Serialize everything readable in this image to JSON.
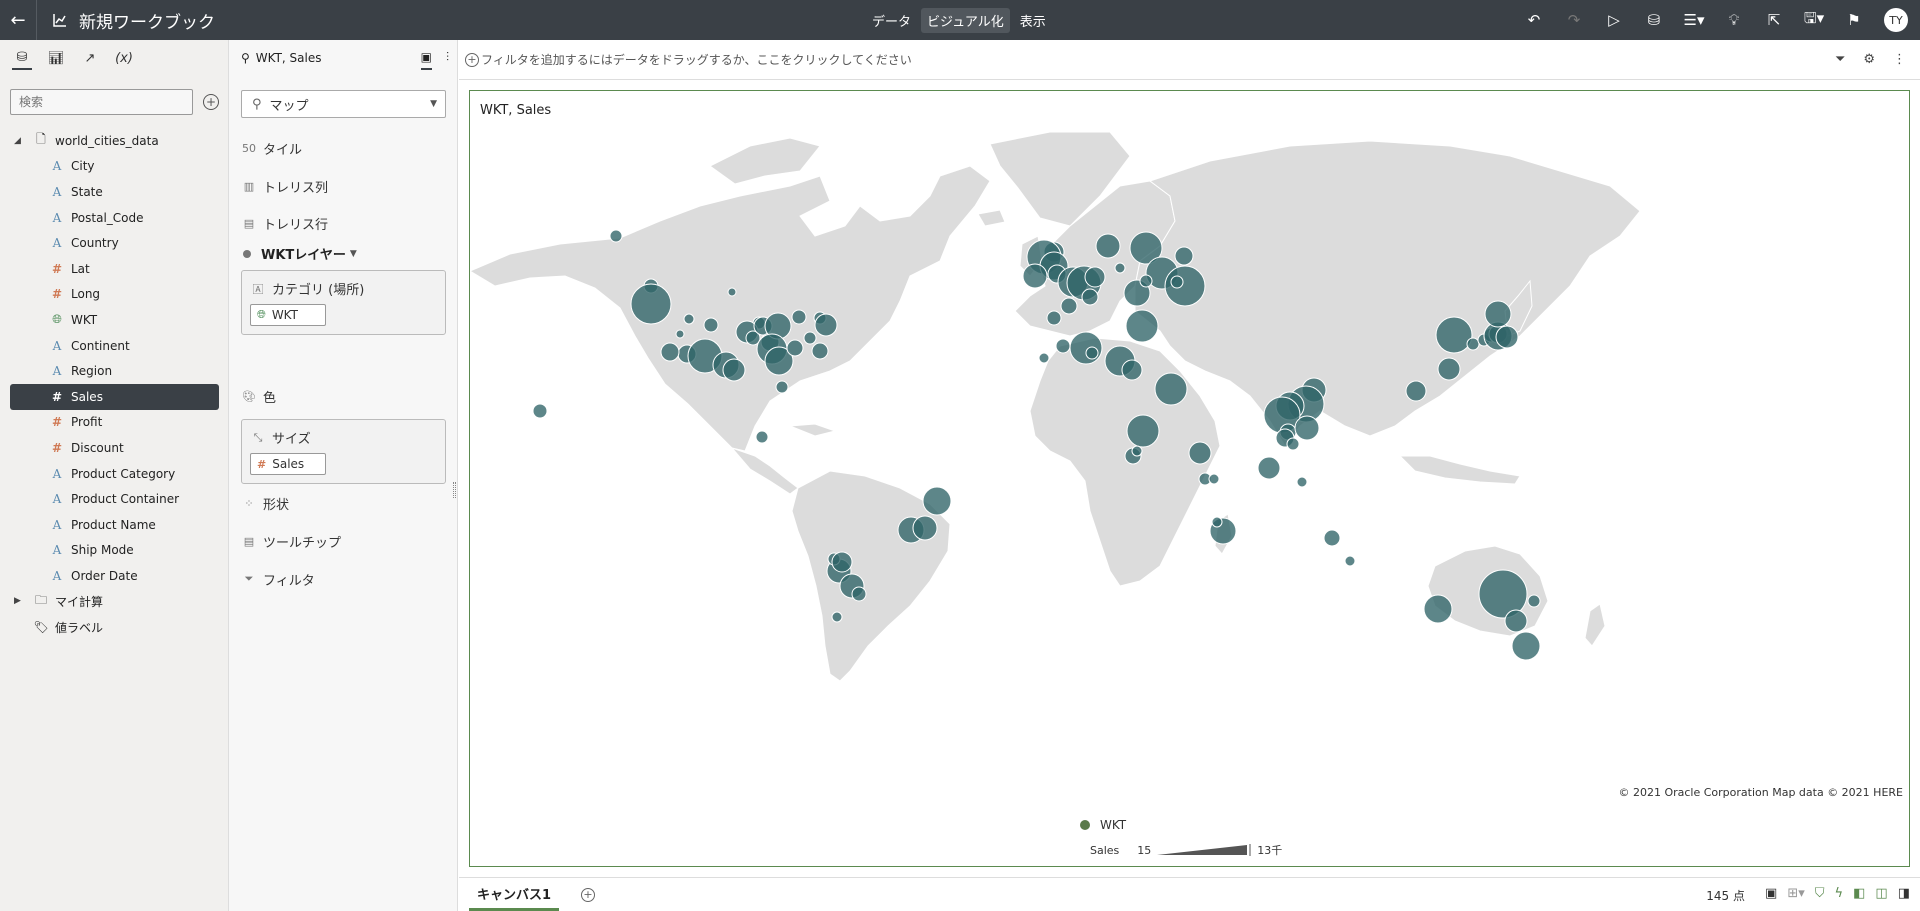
{
  "app": {
    "title": "新規ワークブック",
    "modes": [
      "データ",
      "ビジュアル化",
      "表示"
    ],
    "active_mode": "ビジュアル化",
    "avatar_initials": "TY"
  },
  "data_panel": {
    "search_placeholder": "検索",
    "dataset": "world_cities_data",
    "fields": [
      {
        "name": "City",
        "kind": "attribute"
      },
      {
        "name": "State",
        "kind": "attribute"
      },
      {
        "name": "Postal_Code",
        "kind": "attribute"
      },
      {
        "name": "Country",
        "kind": "attribute"
      },
      {
        "name": "Lat",
        "kind": "measure"
      },
      {
        "name": "Long",
        "kind": "measure"
      },
      {
        "name": "WKT",
        "kind": "geometry"
      },
      {
        "name": "Continent",
        "kind": "attribute"
      },
      {
        "name": "Region",
        "kind": "attribute"
      },
      {
        "name": "Sales",
        "kind": "measure",
        "selected": true
      },
      {
        "name": "Profit",
        "kind": "measure"
      },
      {
        "name": "Discount",
        "kind": "measure"
      },
      {
        "name": "Product Category",
        "kind": "attribute"
      },
      {
        "name": "Product Container",
        "kind": "attribute"
      },
      {
        "name": "Product Name",
        "kind": "attribute"
      },
      {
        "name": "Ship Mode",
        "kind": "attribute"
      },
      {
        "name": "Order Date",
        "kind": "attribute"
      }
    ],
    "my_calculations": "マイ計算",
    "value_labels": "値ラベル"
  },
  "grammar": {
    "header": "WKT, Sales",
    "viz_type": "マップ",
    "tile": "タイル",
    "trellis_columns": "トレリス列",
    "trellis_rows": "トレリス行",
    "layer": "WKTレイヤー",
    "category_label": "カテゴリ (場所)",
    "category_pill": "WKT",
    "color": "色",
    "size_label": "サイズ",
    "size_pill": "Sales",
    "shape": "形状",
    "tooltip": "ツールチップ",
    "filter": "フィルタ"
  },
  "filterbar": {
    "prompt": "フィルタを追加するにはデータをドラッグするか、ここをクリックしてください"
  },
  "viz": {
    "title": "WKT, Sales",
    "copyright": "© 2021 Oracle Corporation   Map data © 2021 HERE",
    "legend_series": "WKT",
    "legend_size_label": "Sales",
    "legend_size_min": "15",
    "legend_size_max": "13千",
    "bubble_color": "#2f6468",
    "legend_color": "#5a7a4a"
  },
  "bottom": {
    "canvas_tab": "キャンバス1",
    "points": "145 点"
  }
}
